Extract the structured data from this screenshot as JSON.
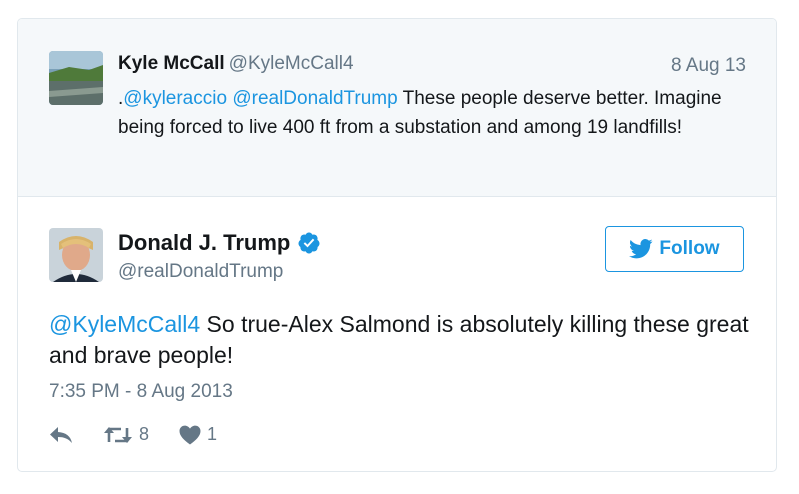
{
  "parent_tweet": {
    "name": "Kyle McCall",
    "handle": "@KyleMcCall4",
    "date": "8 Aug 13",
    "text_prefix": ".",
    "mention1": "@kyleraccio",
    "mention2": "@realDonaldTrump",
    "text_body": " These people deserve better. Imagine being forced to live 400 ft from a substation and among 19 landfills!"
  },
  "main_tweet": {
    "name": "Donald J. Trump",
    "handle": "@realDonaldTrump",
    "follow_label": "Follow",
    "mention": "@KyleMcCall4",
    "text_body": " So true-Alex Salmond is absolutely killing these great and brave people!",
    "timestamp": "7:35 PM - 8 Aug 2013",
    "retweet_count": "8",
    "like_count": "1"
  },
  "colors": {
    "link": "#1b95e0",
    "muted": "#657786",
    "parent_bg": "#f5f8fa",
    "border": "#e1e8ed"
  },
  "icons": {
    "verified": "verified-badge-icon",
    "bird": "twitter-bird-icon",
    "reply": "reply-icon",
    "retweet": "retweet-icon",
    "like": "heart-icon"
  }
}
